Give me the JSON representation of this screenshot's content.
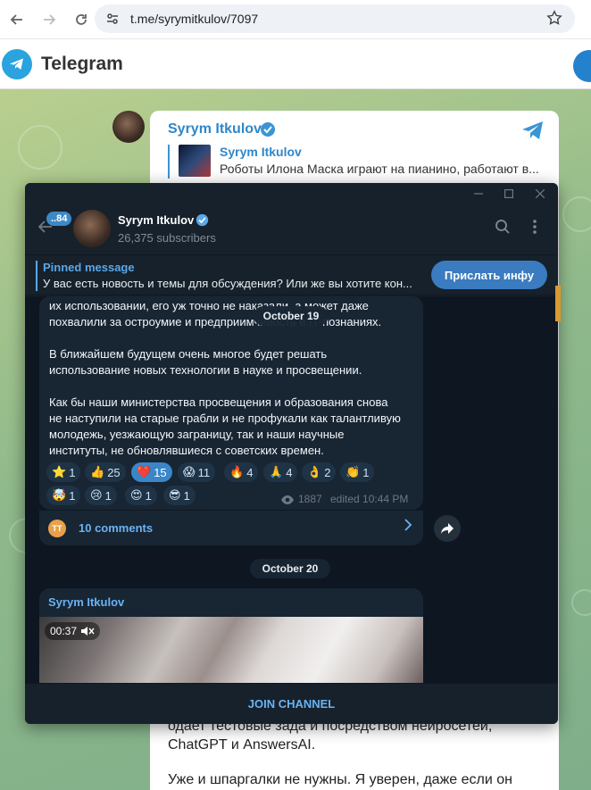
{
  "browser": {
    "url": "t.me/syrymitkulov/7097"
  },
  "web": {
    "brand": "Telegram",
    "post": {
      "channel_name": "Syrym Itkulov",
      "forward_name": "Syrym Itkulov",
      "forward_text": "Роботы Илона Маска играют на пианино, работают в...",
      "bottom_lines": [
        "одает тестовые зада и посредством нейросетей,",
        "ChatGPT и AnswersAI.",
        "",
        "Уже и шпаргалки не нужны. Я уверен, даже если он"
      ]
    }
  },
  "app": {
    "header": {
      "unread_count": "..84",
      "channel_name": "Syrym Itkulov",
      "subscribers": "26,375 subscribers"
    },
    "pinned": {
      "title": "Pinned message",
      "text": "У вас есть новость и темы для обсуждения? Или же вы хотите кон...",
      "button": "Прислать инфу"
    },
    "message": {
      "lines": [
        "их использовании, его уж точно не наказали, а может даже",
        "похвалили за остроумие и предприимчивость в IT-познаниях.",
        "",
        "В ближайшем будущем очень многое будет решать",
        "использование новых технологии в науке и просвещении.",
        "",
        "Как бы наши министерства просвещения и образования снова",
        "не наступили на старые грабли и не профукали как талантливую",
        "молодежь, уезжающую заграницу, так и наши научные",
        "институты, не обновлявшиеся с советских времен."
      ],
      "reactions_row1": [
        {
          "emoji": "⭐",
          "count": "1",
          "active": false
        },
        {
          "emoji": "👍",
          "count": "25",
          "active": false
        },
        {
          "emoji": "❤️",
          "count": "15",
          "active": true
        },
        {
          "emoji": "😱",
          "count": "11",
          "active": false
        },
        {
          "emoji": "🔥",
          "count": "4",
          "active": false
        },
        {
          "emoji": "🙏",
          "count": "4",
          "active": false
        },
        {
          "emoji": "👌",
          "count": "2",
          "active": false
        },
        {
          "emoji": "👏",
          "count": "1",
          "active": false
        }
      ],
      "reactions_row2": [
        {
          "emoji": "🤯",
          "count": "1",
          "active": false
        },
        {
          "emoji": "😢",
          "count": "1",
          "active": false
        },
        {
          "emoji": "😍",
          "count": "1",
          "active": false
        },
        {
          "emoji": "😎",
          "count": "1",
          "active": false
        }
      ],
      "views": "1887",
      "edited": "edited 10:44 PM",
      "comments_avatar": "TT",
      "comments": "10 comments"
    },
    "dates": {
      "floating": "October 19",
      "separator": "October 20"
    },
    "next_post": {
      "author": "Syrym Itkulov",
      "video_time": "00:37"
    },
    "join_label": "JOIN CHANNEL"
  }
}
